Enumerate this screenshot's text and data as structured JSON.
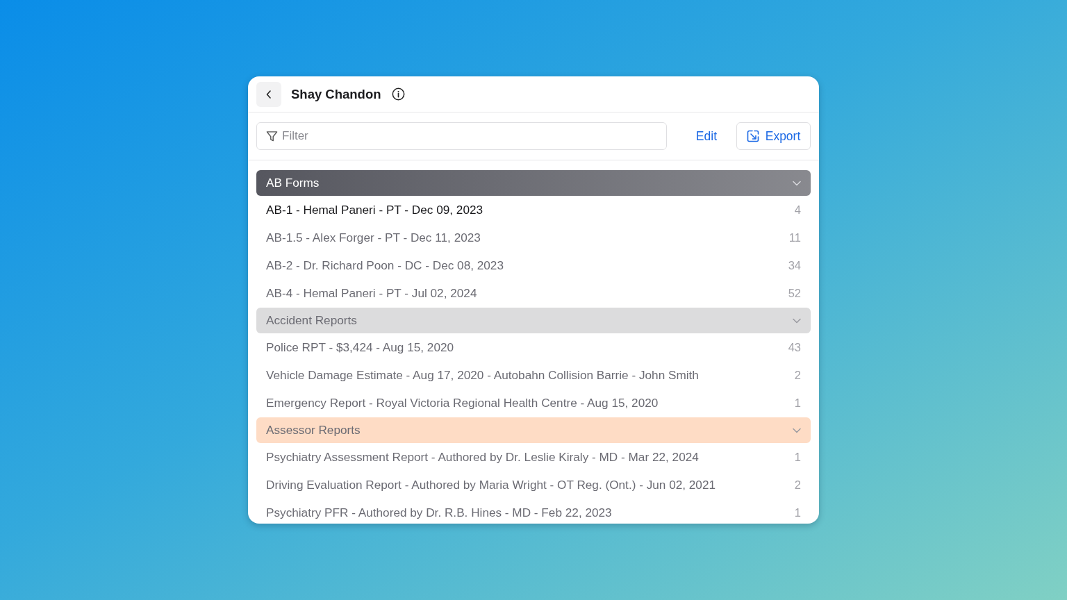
{
  "header": {
    "title": "Shay Chandon"
  },
  "toolbar": {
    "filter": {
      "placeholder": "Filter"
    },
    "edit_label": "Edit",
    "export_label": "Export"
  },
  "groups": [
    {
      "title": "AB Forms",
      "color": "#56575f",
      "expanded": true,
      "items": [
        {
          "label": "AB-1 - Hemal Paneri - PT - Dec 09, 2023",
          "count": "4",
          "selected": true
        },
        {
          "label": "AB-1.5 - Alex Forger - PT - Dec 11, 2023",
          "count": "11",
          "selected": false
        },
        {
          "label": "AB-2 - Dr. Richard Poon - DC - Dec 08, 2023",
          "count": "34",
          "selected": false
        },
        {
          "label": "AB-4 - Hemal Paneri - PT - Jul 02, 2024",
          "count": "52",
          "selected": false
        }
      ]
    },
    {
      "title": "Accident Reports",
      "color": "#dcdcdd",
      "expanded": true,
      "items": [
        {
          "label": "Police RPT - $3,424 - Aug 15, 2020",
          "count": "43",
          "selected": false
        },
        {
          "label": "Vehicle Damage Estimate - Aug 17, 2020 - Autobahn Collision Barrie - John Smith",
          "count": "2",
          "selected": false
        },
        {
          "label": "Emergency Report - Royal Victoria Regional Health Centre - Aug 15, 2020",
          "count": "1",
          "selected": false
        }
      ]
    },
    {
      "title": "Assessor Reports",
      "color": "#fedcc5",
      "expanded": true,
      "items": [
        {
          "label": "Psychiatry Assessment Report - Authored by Dr. Leslie Kiraly - MD - Mar 22, 2024",
          "count": "1",
          "selected": false
        },
        {
          "label": "Driving Evaluation Report - Authored by Maria Wright - OT Reg. (Ont.) - Jun 02, 2021",
          "count": "2",
          "selected": false
        },
        {
          "label": "Psychiatry PFR - Authored by Dr. R.B. Hines - MD - Feb 22, 2023",
          "count": "1",
          "selected": false
        }
      ]
    }
  ]
}
